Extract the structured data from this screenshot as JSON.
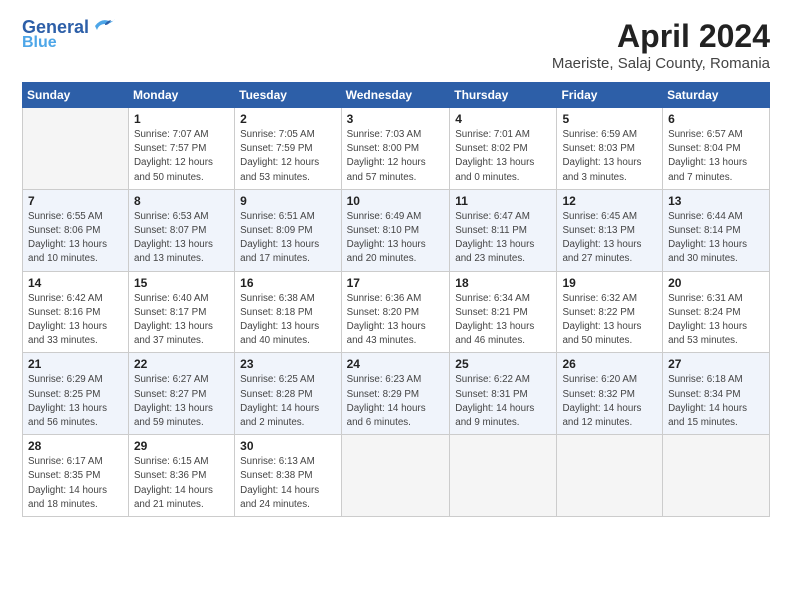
{
  "header": {
    "logo_line1": "General",
    "logo_line2": "Blue",
    "title": "April 2024",
    "subtitle": "Maeriste, Salaj County, Romania"
  },
  "days_of_week": [
    "Sunday",
    "Monday",
    "Tuesday",
    "Wednesday",
    "Thursday",
    "Friday",
    "Saturday"
  ],
  "weeks": [
    [
      {
        "num": "",
        "detail": ""
      },
      {
        "num": "1",
        "detail": "Sunrise: 7:07 AM\nSunset: 7:57 PM\nDaylight: 12 hours\nand 50 minutes."
      },
      {
        "num": "2",
        "detail": "Sunrise: 7:05 AM\nSunset: 7:59 PM\nDaylight: 12 hours\nand 53 minutes."
      },
      {
        "num": "3",
        "detail": "Sunrise: 7:03 AM\nSunset: 8:00 PM\nDaylight: 12 hours\nand 57 minutes."
      },
      {
        "num": "4",
        "detail": "Sunrise: 7:01 AM\nSunset: 8:02 PM\nDaylight: 13 hours\nand 0 minutes."
      },
      {
        "num": "5",
        "detail": "Sunrise: 6:59 AM\nSunset: 8:03 PM\nDaylight: 13 hours\nand 3 minutes."
      },
      {
        "num": "6",
        "detail": "Sunrise: 6:57 AM\nSunset: 8:04 PM\nDaylight: 13 hours\nand 7 minutes."
      }
    ],
    [
      {
        "num": "7",
        "detail": "Sunrise: 6:55 AM\nSunset: 8:06 PM\nDaylight: 13 hours\nand 10 minutes."
      },
      {
        "num": "8",
        "detail": "Sunrise: 6:53 AM\nSunset: 8:07 PM\nDaylight: 13 hours\nand 13 minutes."
      },
      {
        "num": "9",
        "detail": "Sunrise: 6:51 AM\nSunset: 8:09 PM\nDaylight: 13 hours\nand 17 minutes."
      },
      {
        "num": "10",
        "detail": "Sunrise: 6:49 AM\nSunset: 8:10 PM\nDaylight: 13 hours\nand 20 minutes."
      },
      {
        "num": "11",
        "detail": "Sunrise: 6:47 AM\nSunset: 8:11 PM\nDaylight: 13 hours\nand 23 minutes."
      },
      {
        "num": "12",
        "detail": "Sunrise: 6:45 AM\nSunset: 8:13 PM\nDaylight: 13 hours\nand 27 minutes."
      },
      {
        "num": "13",
        "detail": "Sunrise: 6:44 AM\nSunset: 8:14 PM\nDaylight: 13 hours\nand 30 minutes."
      }
    ],
    [
      {
        "num": "14",
        "detail": "Sunrise: 6:42 AM\nSunset: 8:16 PM\nDaylight: 13 hours\nand 33 minutes."
      },
      {
        "num": "15",
        "detail": "Sunrise: 6:40 AM\nSunset: 8:17 PM\nDaylight: 13 hours\nand 37 minutes."
      },
      {
        "num": "16",
        "detail": "Sunrise: 6:38 AM\nSunset: 8:18 PM\nDaylight: 13 hours\nand 40 minutes."
      },
      {
        "num": "17",
        "detail": "Sunrise: 6:36 AM\nSunset: 8:20 PM\nDaylight: 13 hours\nand 43 minutes."
      },
      {
        "num": "18",
        "detail": "Sunrise: 6:34 AM\nSunset: 8:21 PM\nDaylight: 13 hours\nand 46 minutes."
      },
      {
        "num": "19",
        "detail": "Sunrise: 6:32 AM\nSunset: 8:22 PM\nDaylight: 13 hours\nand 50 minutes."
      },
      {
        "num": "20",
        "detail": "Sunrise: 6:31 AM\nSunset: 8:24 PM\nDaylight: 13 hours\nand 53 minutes."
      }
    ],
    [
      {
        "num": "21",
        "detail": "Sunrise: 6:29 AM\nSunset: 8:25 PM\nDaylight: 13 hours\nand 56 minutes."
      },
      {
        "num": "22",
        "detail": "Sunrise: 6:27 AM\nSunset: 8:27 PM\nDaylight: 13 hours\nand 59 minutes."
      },
      {
        "num": "23",
        "detail": "Sunrise: 6:25 AM\nSunset: 8:28 PM\nDaylight: 14 hours\nand 2 minutes."
      },
      {
        "num": "24",
        "detail": "Sunrise: 6:23 AM\nSunset: 8:29 PM\nDaylight: 14 hours\nand 6 minutes."
      },
      {
        "num": "25",
        "detail": "Sunrise: 6:22 AM\nSunset: 8:31 PM\nDaylight: 14 hours\nand 9 minutes."
      },
      {
        "num": "26",
        "detail": "Sunrise: 6:20 AM\nSunset: 8:32 PM\nDaylight: 14 hours\nand 12 minutes."
      },
      {
        "num": "27",
        "detail": "Sunrise: 6:18 AM\nSunset: 8:34 PM\nDaylight: 14 hours\nand 15 minutes."
      }
    ],
    [
      {
        "num": "28",
        "detail": "Sunrise: 6:17 AM\nSunset: 8:35 PM\nDaylight: 14 hours\nand 18 minutes."
      },
      {
        "num": "29",
        "detail": "Sunrise: 6:15 AM\nSunset: 8:36 PM\nDaylight: 14 hours\nand 21 minutes."
      },
      {
        "num": "30",
        "detail": "Sunrise: 6:13 AM\nSunset: 8:38 PM\nDaylight: 14 hours\nand 24 minutes."
      },
      {
        "num": "",
        "detail": ""
      },
      {
        "num": "",
        "detail": ""
      },
      {
        "num": "",
        "detail": ""
      },
      {
        "num": "",
        "detail": ""
      }
    ]
  ]
}
